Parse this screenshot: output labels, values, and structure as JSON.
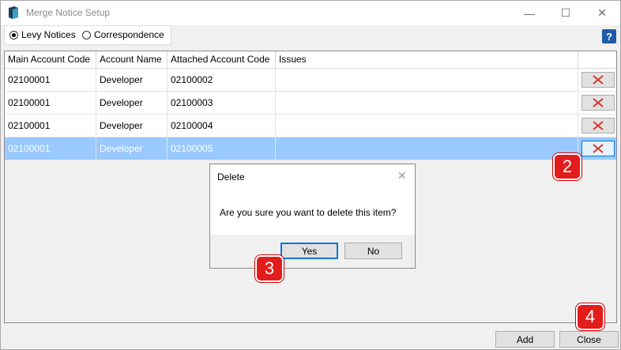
{
  "window": {
    "title": "Merge Notice Setup",
    "minimize_glyph": "—",
    "maximize_glyph": "☐",
    "close_glyph": "✕"
  },
  "filter": {
    "options": [
      "Levy Notices",
      "Correspondence"
    ],
    "selected": "Levy Notices"
  },
  "help": {
    "label": "?"
  },
  "table": {
    "columns": [
      "Main Account Code",
      "Account Name",
      "Attached Account Code",
      "Issues"
    ],
    "rows": [
      {
        "main": "02100001",
        "name": "Developer",
        "attached": "02100002",
        "issues": ""
      },
      {
        "main": "02100001",
        "name": "Developer",
        "attached": "02100003",
        "issues": ""
      },
      {
        "main": "02100001",
        "name": "Developer",
        "attached": "02100004",
        "issues": ""
      },
      {
        "main": "02100001",
        "name": "Developer",
        "attached": "02100005",
        "issues": ""
      }
    ],
    "selected_row": 3
  },
  "dialog": {
    "title": "Delete",
    "close_glyph": "✕",
    "message": "Are you sure you want to delete this item?",
    "yes_label": "Yes",
    "no_label": "No"
  },
  "footer": {
    "add_label": "Add",
    "close_label": "Close"
  },
  "annotations": [
    "2",
    "3",
    "4"
  ],
  "colors": {
    "selection": "#99c9ff",
    "badge": "#e31c1c",
    "delete_x": "#d9362b",
    "focus": "#0078d7"
  },
  "icons": {
    "app": "database-icon",
    "delete": "delete-x-icon",
    "help": "help-icon"
  }
}
